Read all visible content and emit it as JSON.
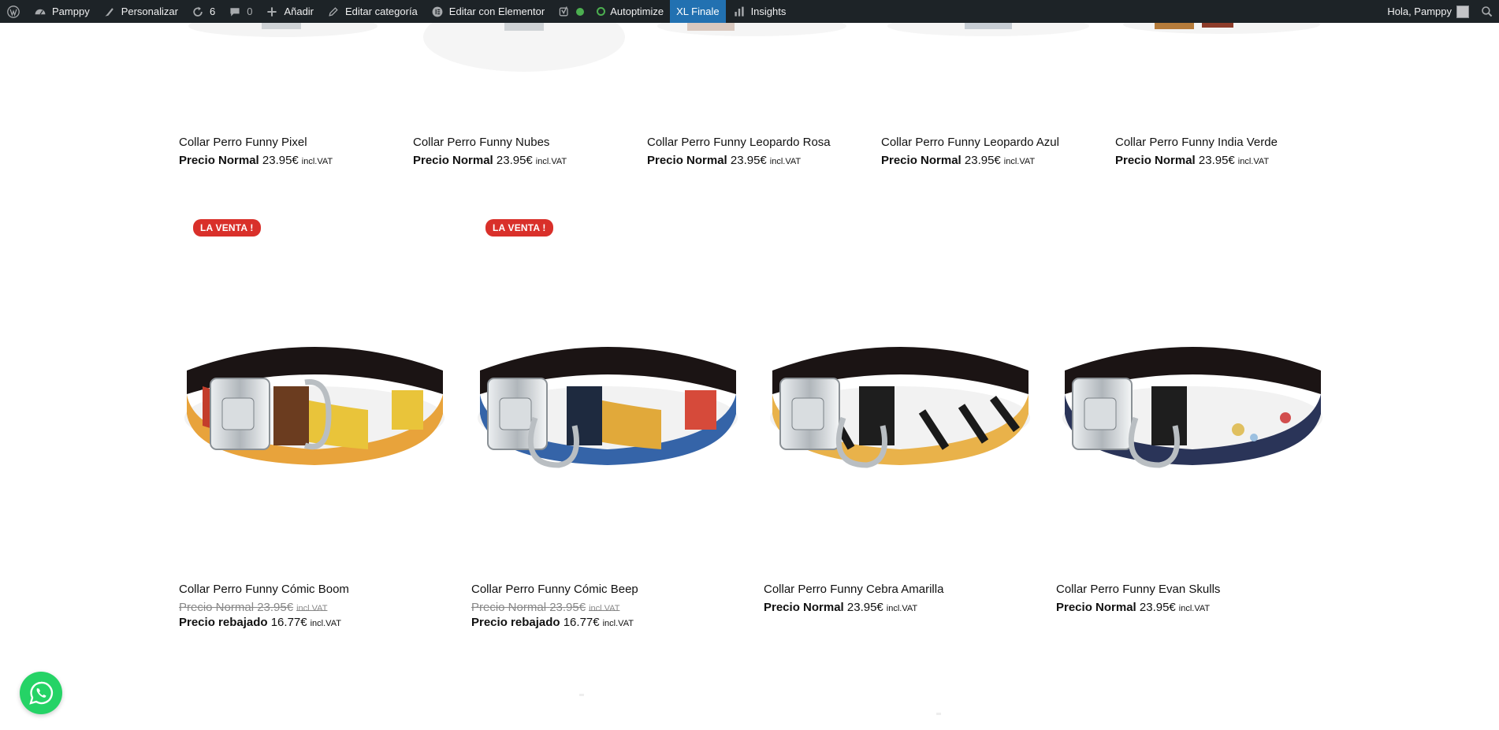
{
  "adminbar": {
    "site_name": "Pamppy",
    "customize": "Personalizar",
    "updates_count": "6",
    "comments_count": "0",
    "new": "Añadir",
    "edit_category": "Editar categoría",
    "edit_elementor": "Editar con Elementor",
    "autoptimize": "Autoptimize",
    "xl_finale": "XL Finale",
    "insights": "Insights",
    "greeting": "Hola, Pamppy"
  },
  "top_row": [
    {
      "title": "Collar Perro Funny Pixel",
      "price_label": "Precio Normal",
      "price": "23.95€",
      "vat": "incl.VAT"
    },
    {
      "title": "Collar Perro Funny Nubes",
      "price_label": "Precio Normal",
      "price": "23.95€",
      "vat": "incl.VAT"
    },
    {
      "title": "Collar Perro Funny Leopardo Rosa",
      "price_label": "Precio Normal",
      "price": "23.95€",
      "vat": "incl.VAT"
    },
    {
      "title": "Collar Perro Funny Leopardo Azul",
      "price_label": "Precio Normal",
      "price": "23.95€",
      "vat": "incl.VAT"
    },
    {
      "title": "Collar Perro Funny India Verde",
      "price_label": "Precio Normal",
      "price": "23.95€",
      "vat": "incl.VAT"
    }
  ],
  "second_row": [
    {
      "badge": "LA VENTA !",
      "title": "Collar Perro Funny Cómic Boom",
      "old_label": "Precio Normal",
      "old_price": "23.95€",
      "old_vat": "incl.VAT",
      "sale_label": "Precio rebajado",
      "sale_price": "16.77€",
      "sale_vat": "incl.VAT"
    },
    {
      "badge": "LA VENTA !",
      "title": "Collar Perro Funny Cómic Beep",
      "old_label": "Precio Normal",
      "old_price": "23.95€",
      "old_vat": "incl.VAT",
      "sale_label": "Precio rebajado",
      "sale_price": "16.77€",
      "sale_vat": "incl.VAT"
    },
    {
      "title": "Collar Perro Funny Cebra Amarilla",
      "price_label": "Precio Normal",
      "price": "23.95€",
      "vat": "incl.VAT"
    },
    {
      "title": "Collar Perro Funny Evan Skulls",
      "price_label": "Precio Normal",
      "price": "23.95€",
      "vat": "incl.VAT"
    }
  ],
  "colors": {
    "adminbar_bg": "#1d2327",
    "active_tab": "#2271b1",
    "sale_badge": "#d9302a",
    "whatsapp": "#25d366"
  }
}
